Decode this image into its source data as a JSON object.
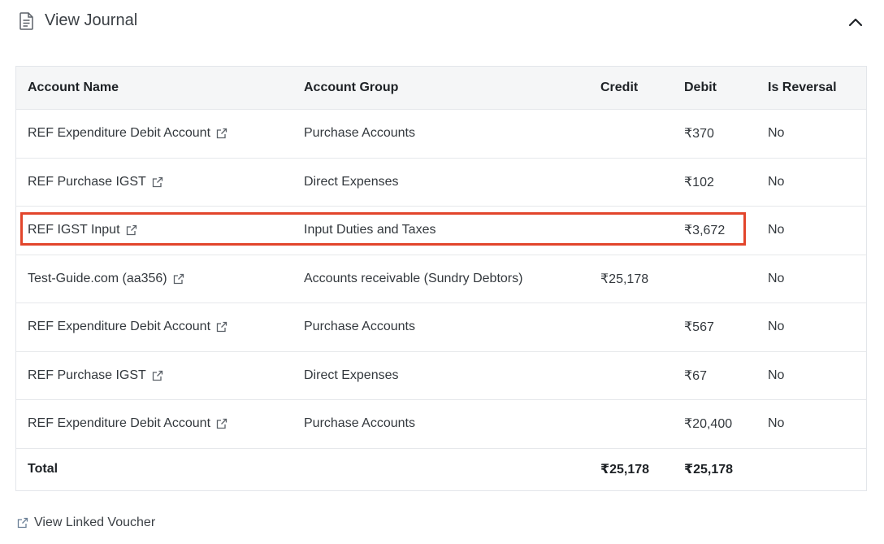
{
  "header": {
    "title": "View Journal",
    "doc_icon": "document-icon",
    "collapse_icon": "chevron-up-icon"
  },
  "table": {
    "columns": [
      "Account Name",
      "Account Group",
      "Credit",
      "Debit",
      "Is Reversal"
    ],
    "rows": [
      {
        "account": "REF Expenditure Debit Account",
        "group": "Purchase Accounts",
        "credit": "",
        "debit": "₹370",
        "reversal": "No"
      },
      {
        "account": "REF Purchase IGST",
        "group": "Direct Expenses",
        "credit": "",
        "debit": "₹102",
        "reversal": "No"
      },
      {
        "account": "REF IGST Input",
        "group": "Input Duties and Taxes",
        "credit": "",
        "debit": "₹3,672",
        "reversal": "No"
      },
      {
        "account": "Test-Guide.com (aa356)",
        "group": "Accounts receivable (Sundry Debtors)",
        "credit": "₹25,178",
        "debit": "",
        "reversal": "No"
      },
      {
        "account": "REF Expenditure Debit Account",
        "group": "Purchase Accounts",
        "credit": "",
        "debit": "₹567",
        "reversal": "No"
      },
      {
        "account": "REF Purchase IGST",
        "group": "Direct Expenses",
        "credit": "",
        "debit": "₹67",
        "reversal": "No"
      },
      {
        "account": "REF Expenditure Debit Account",
        "group": "Purchase Accounts",
        "credit": "",
        "debit": "₹20,400",
        "reversal": "No"
      }
    ],
    "total": {
      "label": "Total",
      "credit": "₹25,178",
      "debit": "₹25,178"
    }
  },
  "highlight": {
    "row_index": 2,
    "color": "#e2452b"
  },
  "footer": {
    "link_label": "View Linked Voucher",
    "icon": "external-link-icon"
  },
  "colors": {
    "header_bg": "#f5f6f7",
    "border": "#e3e6ea",
    "text": "#33383d"
  }
}
